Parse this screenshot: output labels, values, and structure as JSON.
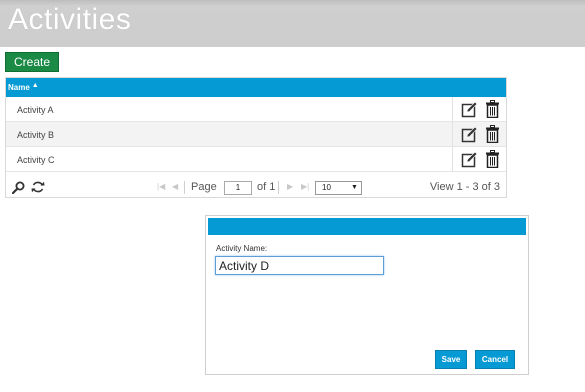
{
  "page": {
    "title": "Activities"
  },
  "toolbar": {
    "create_label": "Create"
  },
  "grid": {
    "columns": [
      {
        "label": "Name",
        "sort": "ascending"
      }
    ],
    "rows": [
      {
        "name": "Activity A"
      },
      {
        "name": "Activity B"
      },
      {
        "name": "Activity C"
      }
    ],
    "row_action_icons": [
      "edit-icon",
      "trash-icon"
    ]
  },
  "pager": {
    "page_label": "Page",
    "current_page": "1",
    "of_label": "of 1",
    "rows_per_page": "10",
    "view_label": "View 1 - 3 of 3",
    "icons": [
      "search-icon",
      "refresh-icon",
      "first-page-icon",
      "prev-page-icon",
      "next-page-icon",
      "last-page-icon"
    ]
  },
  "dialog": {
    "field_label": "Activity Name:",
    "field_value": "Activity D",
    "save_label": "Save",
    "cancel_label": "Cancel"
  },
  "colors": {
    "header_gray": "#cdcdcd",
    "create_green": "#1a8a45",
    "accent_blue": "#069ad4",
    "alt_row": "#f3f3f3"
  }
}
